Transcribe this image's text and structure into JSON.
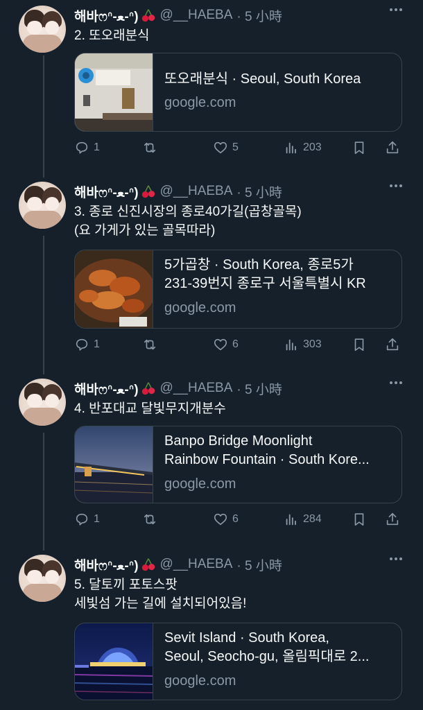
{
  "colors": {
    "background": "#15202b",
    "text": "#f7f9f9",
    "muted": "#8b98a5",
    "border": "#38444d"
  },
  "author": {
    "name": "해바ෆ⁠ᐢ⁠-⁠ﻌ⁠-⁠ᐢ⁠)",
    "handle": "@__HAEBA",
    "time": "· 5 小時",
    "emoji": "cherry-icon"
  },
  "tweets": [
    {
      "text": [
        "2. 또오래분식"
      ],
      "card": {
        "title": [
          "또오래분식 · Seoul, South Korea"
        ],
        "domain": "google.com",
        "thumb": "restaurant-interior-image"
      },
      "stats": {
        "replies": "1",
        "retweets": "",
        "likes": "5",
        "views": "203"
      }
    },
    {
      "text": [
        "3. 종로 신진시장의 종로40가길(곱창골목)",
        "(요 가게가 있는 골목따라)"
      ],
      "card": {
        "title": [
          "5가곱창 · South Korea, 종로5가",
          "231-39번지 종로구 서울특별시 KR"
        ],
        "domain": "google.com",
        "thumb": "gopchang-food-image"
      },
      "stats": {
        "replies": "1",
        "retweets": "",
        "likes": "6",
        "views": "303"
      }
    },
    {
      "text": [
        "4. 반포대교 달빛무지개분수"
      ],
      "card": {
        "title": [
          "Banpo Bridge Moonlight",
          "Rainbow Fountain · South Kore..."
        ],
        "domain": "google.com",
        "thumb": "banpo-bridge-night-image"
      },
      "stats": {
        "replies": "1",
        "retweets": "",
        "likes": "6",
        "views": "284"
      }
    },
    {
      "text": [
        "5. 달토끼 포토스팟",
        "세빛섬 가는 길에 설치되어있음!"
      ],
      "card": {
        "title": [
          "Sevit Island · South Korea,",
          "Seoul, Seocho-gu, 올림픽대로 2..."
        ],
        "domain": "google.com",
        "thumb": "sevit-island-night-image"
      },
      "stats": null
    }
  ]
}
